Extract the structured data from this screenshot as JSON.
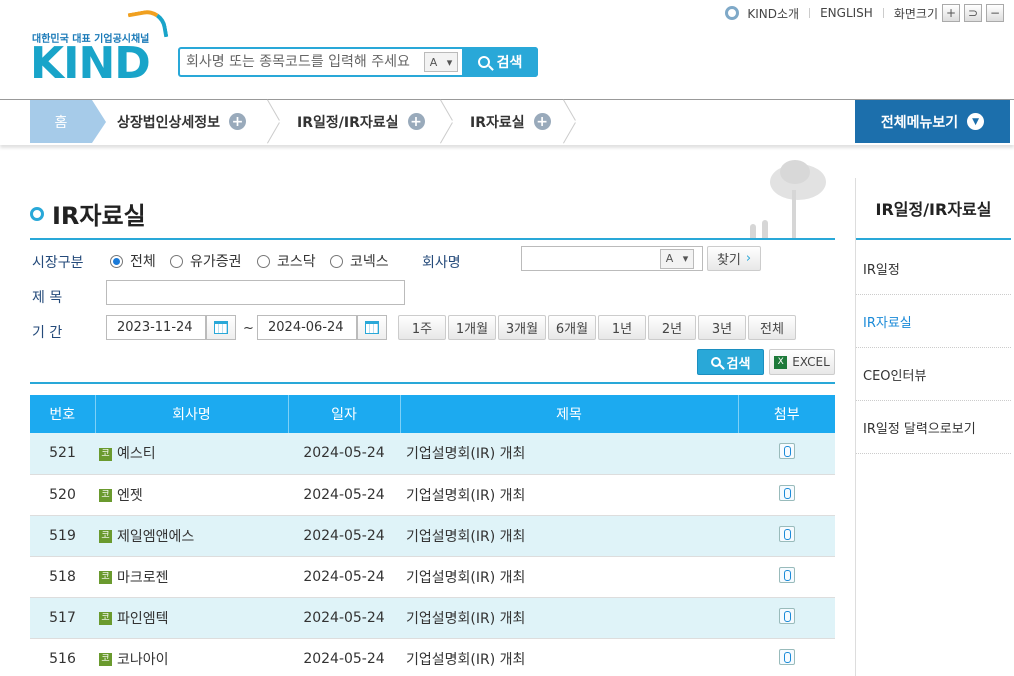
{
  "util": {
    "about": "KIND소개",
    "english": "ENGLISH",
    "font_size": "화면크기",
    "zoom_in": "+",
    "reset": "⊃",
    "zoom_out": "−"
  },
  "logo": {
    "tagline": "대한민국 대표 기업공시채널",
    "word": "KIND"
  },
  "search": {
    "placeholder": "회사명 또는 종목코드를 입력해 주세요",
    "ime": "A",
    "button": "검색"
  },
  "nav": {
    "home": "홈",
    "items": [
      "상장법인상세정보",
      "IR일정/IR자료실",
      "IR자료실"
    ],
    "all_menu": "전체메뉴보기"
  },
  "page": {
    "title": "IR자료실"
  },
  "form": {
    "market_label": "시장구분",
    "markets": [
      "전체",
      "유가증권",
      "코스닥",
      "코넥스"
    ],
    "company_label": "회사명",
    "company_ime": "A",
    "find_button": "찾기",
    "subject_label": "제 목",
    "period_label": "기 간",
    "date_from": "2023-11-24",
    "date_sep": "~",
    "date_to": "2024-06-24",
    "periods": [
      "1주",
      "1개월",
      "3개월",
      "6개월",
      "1년",
      "2년",
      "3년",
      "전체"
    ],
    "search_button": "검색",
    "excel_button": "EXCEL"
  },
  "table": {
    "headers": [
      "번호",
      "회사명",
      "일자",
      "제목",
      "첨부"
    ],
    "market_badge": "코",
    "rows": [
      {
        "no": "521",
        "company": "예스티",
        "date": "2024-05-24",
        "title": "기업설명회(IR) 개최"
      },
      {
        "no": "520",
        "company": "엔젯",
        "date": "2024-05-24",
        "title": "기업설명회(IR) 개최"
      },
      {
        "no": "519",
        "company": "제일엠앤에스",
        "date": "2024-05-24",
        "title": "기업설명회(IR) 개최"
      },
      {
        "no": "518",
        "company": "마크로젠",
        "date": "2024-05-24",
        "title": "기업설명회(IR) 개최"
      },
      {
        "no": "517",
        "company": "파인엠텍",
        "date": "2024-05-24",
        "title": "기업설명회(IR) 개최"
      },
      {
        "no": "516",
        "company": "코나아이",
        "date": "2024-05-24",
        "title": "기업설명회(IR) 개최"
      }
    ]
  },
  "sidebar": {
    "title": "IR일정/IR자료실",
    "items": [
      "IR일정",
      "IR자료실",
      "CEO인터뷰",
      "IR일정 달력으로보기"
    ]
  }
}
